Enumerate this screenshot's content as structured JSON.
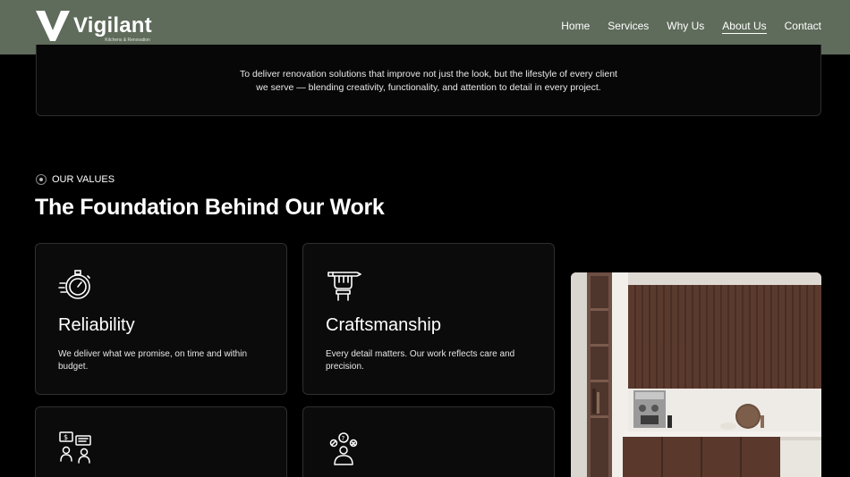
{
  "header": {
    "brand_name": "Vigilant",
    "brand_tagline": "Kitchens & Renovation",
    "nav": [
      {
        "label": "Home"
      },
      {
        "label": "Services"
      },
      {
        "label": "Why Us"
      },
      {
        "label": "About Us",
        "active": true
      },
      {
        "label": "Contact"
      }
    ],
    "bg_color": "#5f6b5b"
  },
  "mission": {
    "line1": "To deliver renovation solutions that improve not just the look, but the lifestyle of every client",
    "line2": "we serve — blending creativity, functionality, and attention to detail in every project."
  },
  "values": {
    "label": "OUR VALUES",
    "title": "The Foundation Behind Our Work",
    "cards": [
      {
        "icon": "stopwatch-icon",
        "title": "Reliability",
        "desc": "We deliver what we promise, on time and within budget."
      },
      {
        "icon": "hand-pencil-icon",
        "title": "Craftsmanship",
        "desc": "Every detail matters. Our work reflects care and precision."
      },
      {
        "icon": "people-chat-icon",
        "title": "",
        "desc": ""
      },
      {
        "icon": "idea-person-icon",
        "title": "",
        "desc": ""
      }
    ]
  },
  "image": {
    "subject": "kitchen-interior"
  }
}
